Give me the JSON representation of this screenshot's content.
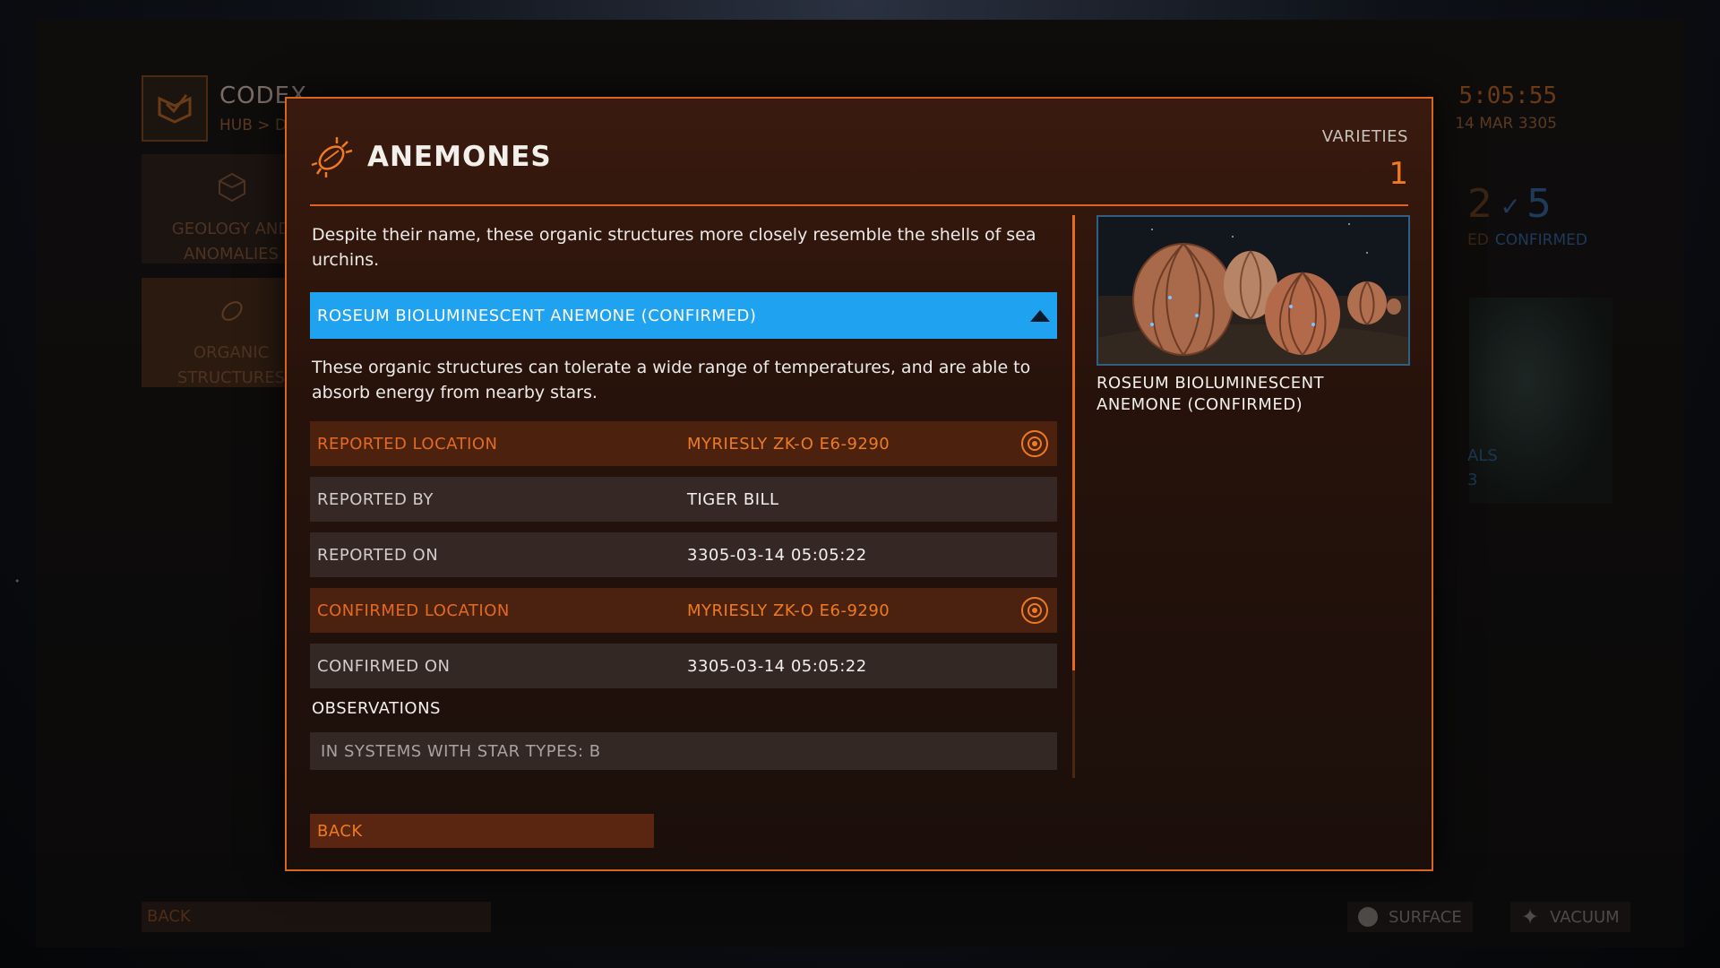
{
  "background": {
    "app_title": "CODEX",
    "breadcrumb": "HUB > DISC",
    "clock": "5:05:55",
    "date": "14 MAR 3305",
    "categories": [
      {
        "label_line1": "GEOLOGY AND",
        "label_line2": "ANOMALIES",
        "icon": "geode-icon"
      },
      {
        "label_line1": "ORGANIC",
        "label_line2": "STRUCTURES",
        "icon": "anemone-icon"
      }
    ],
    "stat_partial_num": "2",
    "stat_partial_lbl": "ED",
    "stat_confirmed_num": "5",
    "stat_confirmed_lbl": "CONFIRMED",
    "side_partial_lbl": "ALS",
    "side_partial_num": "3",
    "back_label": "BACK",
    "footer_surface": "SURFACE",
    "footer_vacuum": "VACUUM"
  },
  "modal": {
    "title": "ANEMONES",
    "title_icon": "anemone-icon",
    "varieties_label": "VARIETIES",
    "varieties_count": "1",
    "description": "Despite their name, these organic structures more closely resemble the shells of sea urchins.",
    "variant": {
      "label": "ROSEUM BIOLUMINESCENT ANEMONE (CONFIRMED)",
      "expanded": true,
      "description": "These organic structures can tolerate a wide range of temperatures, and are able to absorb energy from nearby stars.",
      "details": [
        {
          "key": "REPORTED LOCATION",
          "value": "MYRIESLY ZK-O E6-9290",
          "highlight": true,
          "has_target": true
        },
        {
          "key": "REPORTED BY",
          "value": "TIGER BILL",
          "highlight": false,
          "has_target": false
        },
        {
          "key": "REPORTED ON",
          "value": "3305-03-14 05:05:22",
          "highlight": false,
          "has_target": false
        },
        {
          "key": "CONFIRMED LOCATION",
          "value": "MYRIESLY ZK-O E6-9290",
          "highlight": true,
          "has_target": true
        },
        {
          "key": "CONFIRMED ON",
          "value": "3305-03-14 05:05:22",
          "highlight": false,
          "has_target": false
        }
      ],
      "observations_title": "OBSERVATIONS",
      "observations": "IN SYSTEMS WITH STAR TYPES: B"
    },
    "preview_caption": "ROSEUM BIOLUMINESCENT ANEMONE (CONFIRMED)",
    "back_label": "BACK",
    "colors": {
      "accent": "#f07a22",
      "selection": "#1fa2f0",
      "border": "#d9651e"
    }
  }
}
